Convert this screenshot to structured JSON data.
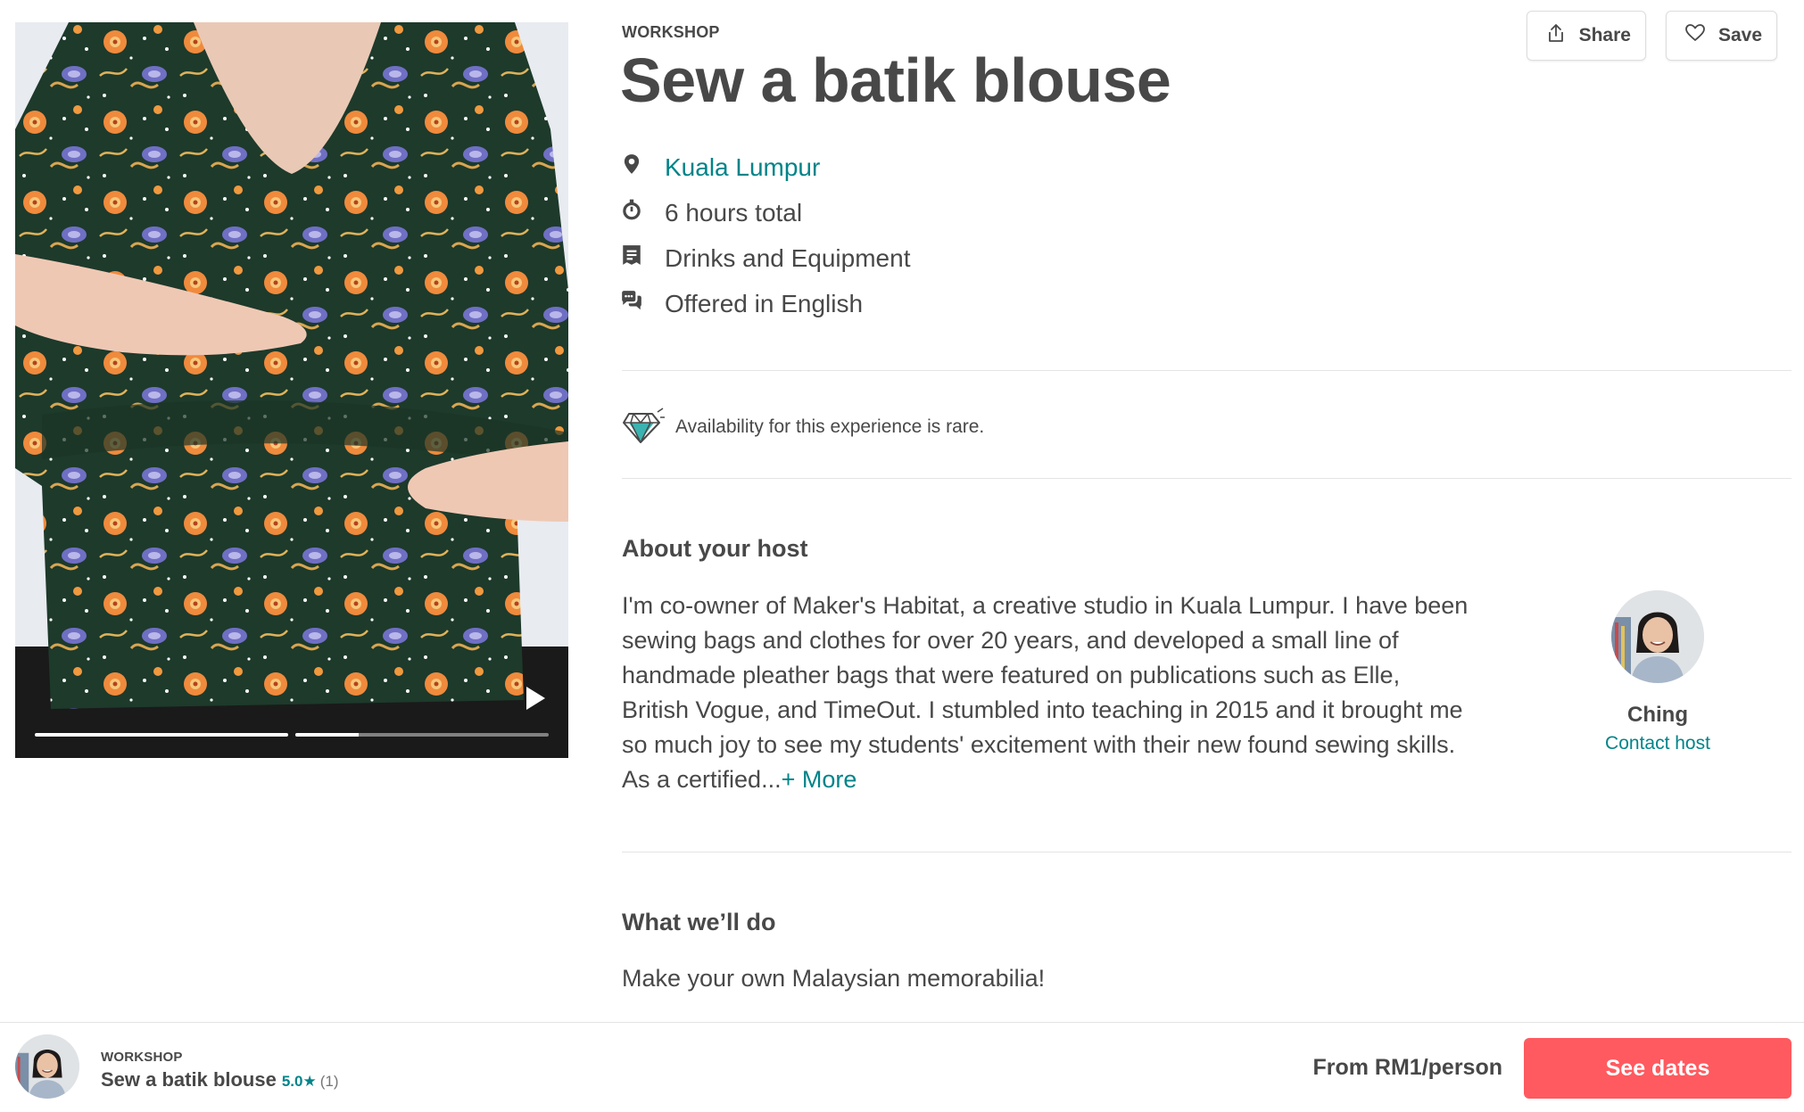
{
  "experience": {
    "category": "WORKSHOP",
    "title": "Sew a batik blouse"
  },
  "actions": {
    "share_label": "Share",
    "save_label": "Save"
  },
  "facts": {
    "location": "Kuala Lumpur",
    "duration": "6 hours total",
    "includes": "Drinks and Equipment",
    "language": "Offered in English"
  },
  "availability_note": "Availability for this experience is rare.",
  "host_section": {
    "heading": "About your host",
    "bio": "I'm co-owner of Maker's Habitat, a creative studio in Kuala Lumpur. I have been sewing bags and clothes for over 20 years, and developed a small line of handmade pleather bags that were featured on publications such as Elle, British Vogue, and TimeOut. I stumbled into teaching in 2015 and it brought me so much joy to see my students' excitement with their new found sewing skills. As a certified...",
    "more_label": "+ More",
    "host_name": "Ching",
    "contact_label": "Contact host"
  },
  "what_section": {
    "heading": "What we’ll do",
    "text": "Make your own Malaysian memorabilia!"
  },
  "media": {
    "progress": [
      1.0,
      0.25
    ]
  },
  "bottom_bar": {
    "category": "WORKSHOP",
    "title": "Sew a batik blouse",
    "rating": "5.0★",
    "review_count": "(1)",
    "price": "From RM1/person",
    "cta_label": "See dates"
  },
  "colors": {
    "accent": "#008489",
    "cta": "#ff5a5f",
    "text": "#484848"
  },
  "icons": [
    "share-icon",
    "heart-icon",
    "location-pin-icon",
    "stopwatch-icon",
    "receipt-icon",
    "speech-bubbles-icon",
    "diamond-icon",
    "play-icon"
  ]
}
